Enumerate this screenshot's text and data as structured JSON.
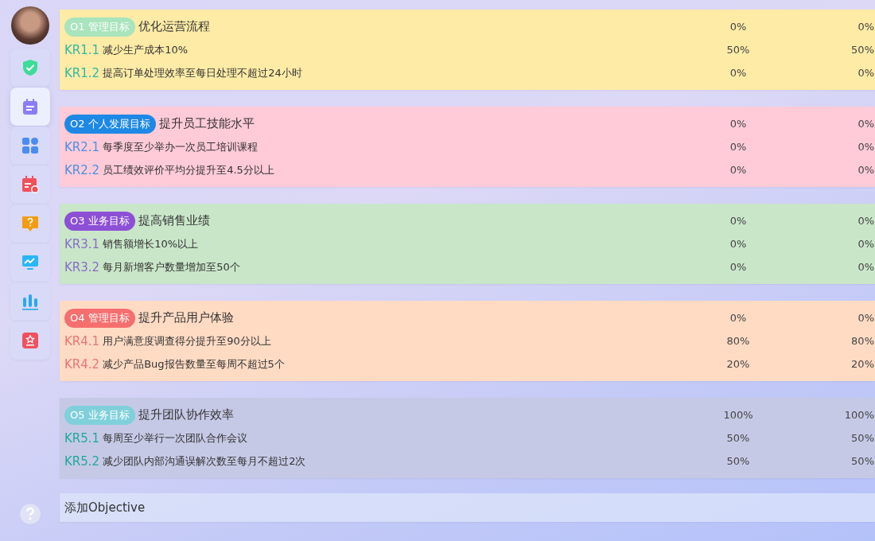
{
  "sidebar": {
    "items": [
      {
        "selected": false
      },
      {
        "selected": true
      },
      {
        "selected": false
      },
      {
        "selected": false
      },
      {
        "selected": false
      },
      {
        "selected": false
      },
      {
        "selected": false
      },
      {
        "selected": false
      }
    ]
  },
  "objectives": [
    {
      "tag": "O1 管理目标",
      "color": "#a8e4bc",
      "title": "优化运营流程",
      "value_1": "0%",
      "value_2": "0%",
      "key_results": [
        {
          "code": "KR1.1",
          "text": "减少生产成本10%",
          "value_1": "50%",
          "value_2": "50%"
        },
        {
          "code": "KR1.2",
          "text": "提高订单处理效率至每日处理不超过24小时",
          "value_1": "0%",
          "value_2": "0%"
        }
      ]
    },
    {
      "tag": "O2 个人发展目标",
      "color": "#1e88e5",
      "title": "提升员工技能水平",
      "value_1": "0%",
      "value_2": "0%",
      "key_results": [
        {
          "code": "KR2.1",
          "text": "每季度至少举办一次员工培训课程",
          "value_1": "0%",
          "value_2": "0%"
        },
        {
          "code": "KR2.2",
          "text": "员工绩效评价平均分提升至4.5分以上",
          "value_1": "0%",
          "value_2": "0%"
        }
      ]
    },
    {
      "tag": "O3 业务目标",
      "color": "#8d4fd6",
      "title": "提高销售业绩",
      "value_1": "0%",
      "value_2": "0%",
      "key_results": [
        {
          "code": "KR3.1",
          "text": "销售额增长10%以上",
          "value_1": "0%",
          "value_2": "0%"
        },
        {
          "code": "KR3.2",
          "text": "每月新增客户数量增加至50个",
          "value_1": "0%",
          "value_2": "0%"
        }
      ]
    },
    {
      "tag": "O4 管理目标",
      "color": "#f56f6f",
      "title": "提升产品用户体验",
      "value_1": "0%",
      "value_2": "0%",
      "key_results": [
        {
          "code": "KR4.1",
          "text": "用户满意度调查得分提升至90分以上",
          "value_1": "80%",
          "value_2": "80%"
        },
        {
          "code": "KR4.2",
          "text": "减少产品Bug报告数量至每周不超过5个",
          "value_1": "20%",
          "value_2": "20%"
        }
      ]
    },
    {
      "tag": "O5 业务目标",
      "color": "#7fd0da",
      "title": "提升团队协作效率",
      "value_1": "100%",
      "value_2": "100%",
      "key_results": [
        {
          "code": "KR5.1",
          "text": "每周至少举行一次团队合作会议",
          "value_1": "50%",
          "value_2": "50%"
        },
        {
          "code": "KR5.2",
          "text": "减少团队内部沟通误解次数至每月不超过2次",
          "value_1": "50%",
          "value_2": "50%"
        }
      ]
    }
  ],
  "add_button": {
    "label": "添加Objective"
  }
}
